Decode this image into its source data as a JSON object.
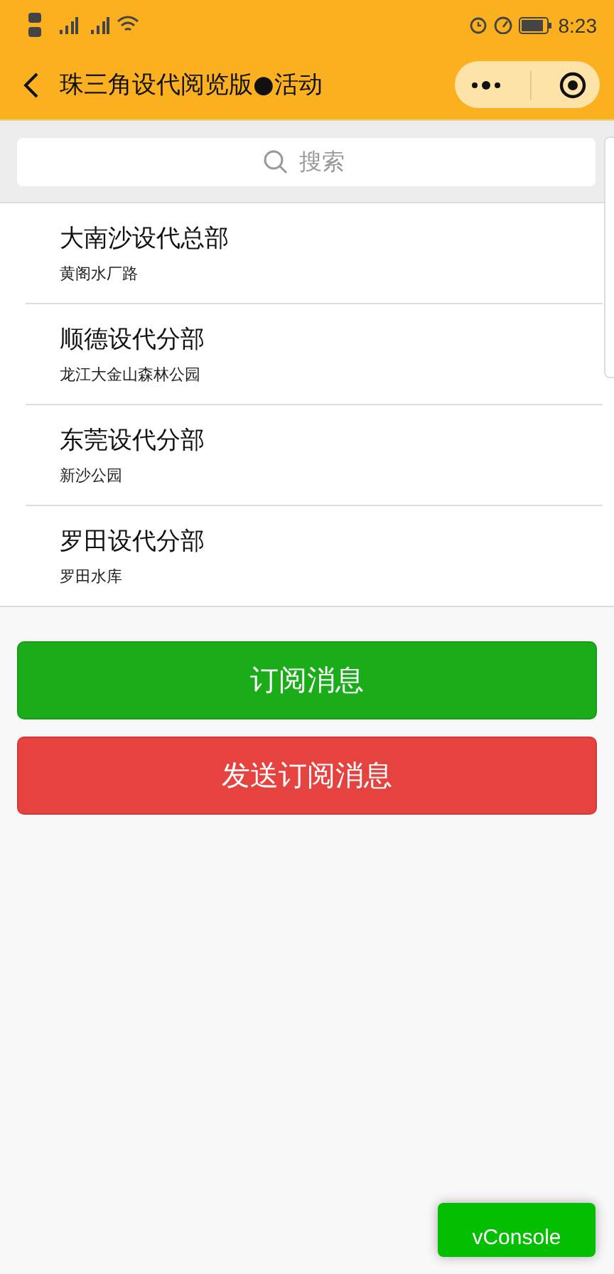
{
  "status_bar": {
    "time": "8:23"
  },
  "nav": {
    "title": "珠三角设代阅览版●活动"
  },
  "search": {
    "placeholder": "搜索"
  },
  "locations": [
    {
      "name": "大南沙设代总部",
      "address": "黄阁水厂路"
    },
    {
      "name": "顺德设代分部",
      "address": "龙江大金山森林公园"
    },
    {
      "name": "东莞设代分部",
      "address": "新沙公园"
    },
    {
      "name": "罗田设代分部",
      "address": "罗田水库"
    }
  ],
  "buttons": [
    {
      "label": "订阅消息",
      "kind": "primary"
    },
    {
      "label": "发送订阅消息",
      "kind": "warn"
    }
  ],
  "console_button": {
    "label": "vConsole"
  }
}
